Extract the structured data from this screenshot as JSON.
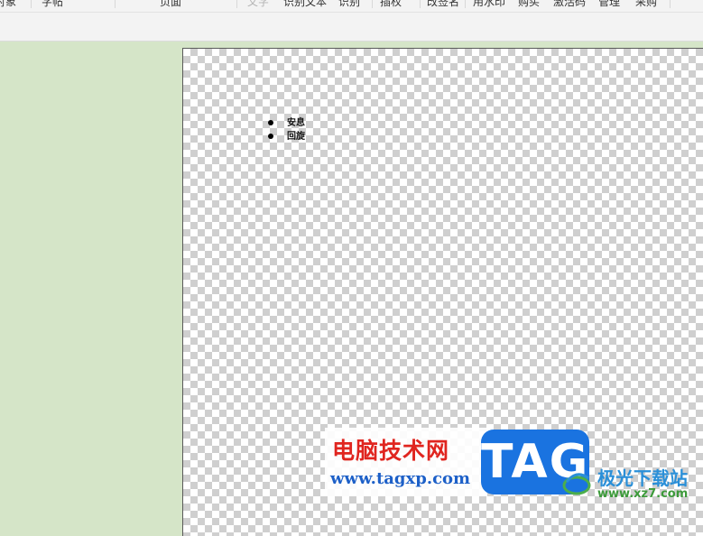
{
  "ribbon": {
    "items": [
      {
        "label": "对象",
        "dim": false
      },
      {
        "label": "字帖",
        "dim": false
      },
      {
        "label": "页面",
        "dim": false
      },
      {
        "label": "文字",
        "dim": true
      },
      {
        "label": "识别文本",
        "dim": false
      },
      {
        "label": "识别",
        "dim": false
      },
      {
        "label": "插权",
        "dim": false
      },
      {
        "label": "改签名",
        "dim": false
      },
      {
        "label": "用水印",
        "dim": false
      },
      {
        "label": "购买",
        "dim": false
      },
      {
        "label": "激活码",
        "dim": false
      },
      {
        "label": "管理",
        "dim": false
      },
      {
        "label": "采购",
        "dim": false
      }
    ]
  },
  "document": {
    "list_items": [
      "安息",
      "回旋"
    ]
  },
  "watermark": {
    "site_name_cn": "电脑技术网",
    "site_url": "www.tagxp.com",
    "tag_text": "TAG",
    "brand_name": "极光下载站",
    "brand_url": "www.xz7.com"
  },
  "colors": {
    "workspace_bg": "#d5e5c8",
    "watermark_red": "#e0251f",
    "watermark_blue": "#1a73e0"
  }
}
